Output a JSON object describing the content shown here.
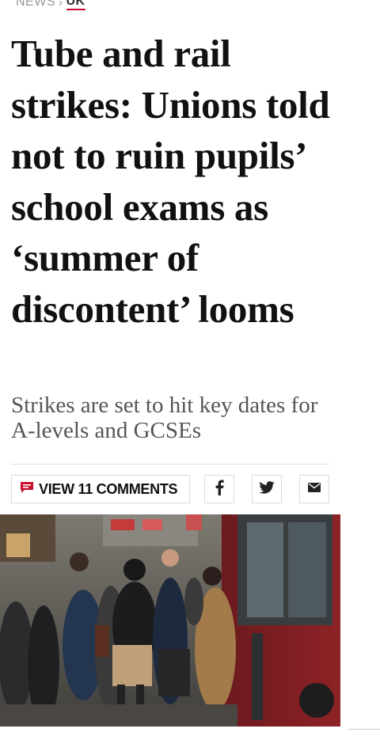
{
  "breadcrumb": {
    "section": "NEWS",
    "separator": "›",
    "current": "UK"
  },
  "article": {
    "headline": "Tube and rail strikes: Unions told not to ruin pupils’ school exams as ‘summer of discontent’ looms",
    "standfirst": "Strikes are set to hit key dates for A-levels and GCSEs"
  },
  "share": {
    "comments_label": "VIEW 11 COMMENTS",
    "facebook_icon": "f",
    "twitter_icon": "twitter-bird",
    "email_icon": "envelope"
  },
  "colors": {
    "accent": "#c8102e",
    "text": "#111111",
    "standfirst": "#555555",
    "border": "#dddddd"
  }
}
